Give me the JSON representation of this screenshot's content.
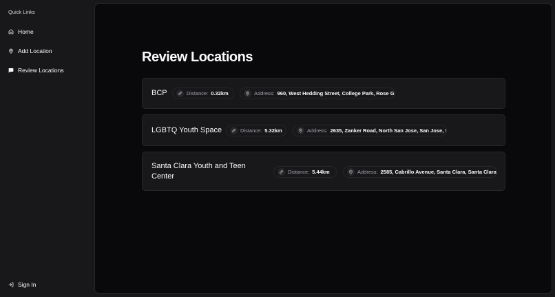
{
  "sidebar": {
    "heading": "Quick Links",
    "items": [
      {
        "label": "Home",
        "icon": "home-icon"
      },
      {
        "label": "Add Location",
        "icon": "map-pin-icon"
      },
      {
        "label": "Review Locations",
        "icon": "message-square-icon"
      }
    ],
    "sign_in": {
      "label": "Sign In",
      "icon": "log-in-icon"
    }
  },
  "main": {
    "title": "Review Locations",
    "distance_label": "Distance:",
    "address_label": "Address:",
    "locations": [
      {
        "name": "BCP",
        "distance": "0.32km",
        "address": "960, West Hedding Street, College Park, Rose G"
      },
      {
        "name": "LGBTQ Youth Space",
        "distance": "5.32km",
        "address": "2635, Zanker Road, North San Jose, San Jose, S"
      },
      {
        "name": "Santa Clara Youth and Teen Center",
        "distance": "5.44km",
        "address": "2585, Cabrillo Avenue, Santa Clara, Santa Clara"
      }
    ]
  },
  "colors": {
    "background": "#09090b",
    "sidebar": "#18181b",
    "card": "#18181b",
    "border": "#27272a",
    "text": "#fafafa",
    "muted": "#a1a1aa"
  }
}
